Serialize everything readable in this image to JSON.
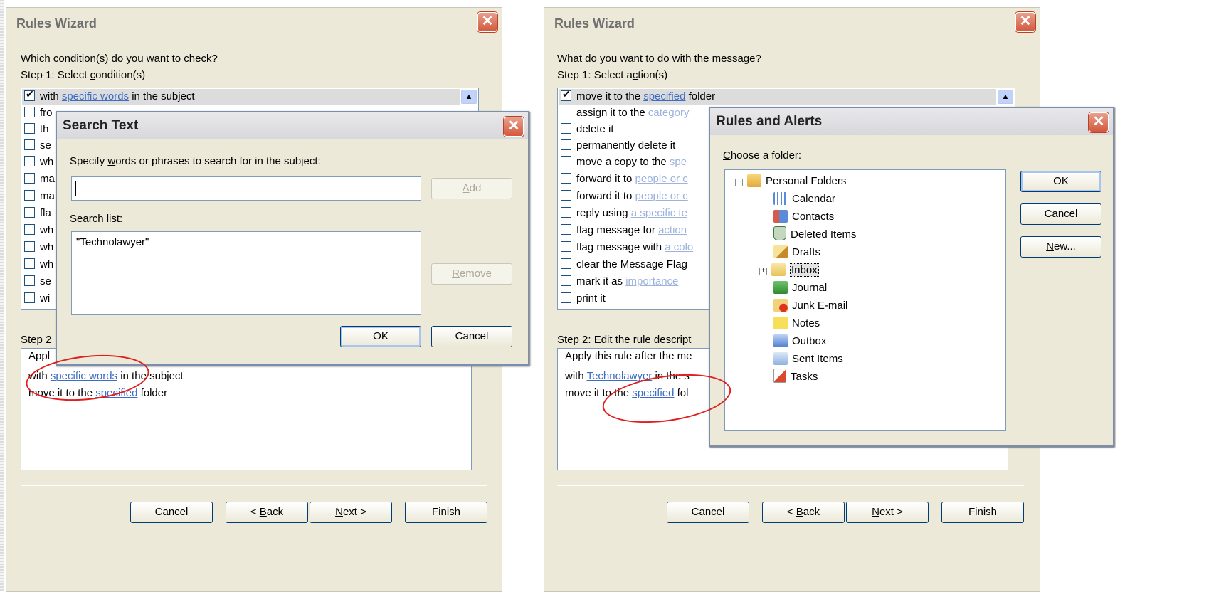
{
  "left_wizard": {
    "title": "Rules Wizard",
    "question": "Which condition(s) do you want to check?",
    "step1_pre": "Step 1: Select ",
    "step1_u": "c",
    "step1_post": "ondition(s)",
    "conditions": [
      {
        "label": "with ",
        "link": "specific words",
        "suffix": " in the subject",
        "checked": true
      },
      {
        "label": "fro"
      },
      {
        "label": "th"
      },
      {
        "label": "se"
      },
      {
        "label": "wh"
      },
      {
        "label": "ma"
      },
      {
        "label": "ma"
      },
      {
        "label": "fla"
      },
      {
        "label": "wh"
      },
      {
        "label": "wh"
      },
      {
        "label": "wh"
      },
      {
        "label": "se"
      },
      {
        "label": "wi"
      }
    ],
    "step2_label": "Step 2",
    "description": {
      "line1": "Appl",
      "line2_pre": "with ",
      "line2_link": "specific words",
      "line2_post": " in the subject",
      "line3_pre": "move it to the ",
      "line3_link": "specified",
      "line3_post": " folder"
    },
    "buttons": {
      "cancel": "Cancel",
      "back_pre": "< ",
      "back_u": "B",
      "back_post": "ack",
      "next_u": "N",
      "next_post": "ext >",
      "finish": "Finish"
    }
  },
  "search_text": {
    "title": "Search Text",
    "prompt_pre": "Specify ",
    "prompt_u": "w",
    "prompt_post": "ords or phrases to search for in the subject:",
    "input_value": "",
    "add_u": "A",
    "add_post": "dd",
    "list_u": "S",
    "list_post": "earch list:",
    "items": [
      "\"Technolawyer\""
    ],
    "remove_u": "R",
    "remove_post": "emove",
    "ok": "OK",
    "cancel": "Cancel"
  },
  "right_wizard": {
    "title": "Rules Wizard",
    "question": "What do you want to do with the message?",
    "step1_pre": "Step 1: Select a",
    "step1_u": "c",
    "step1_post": "tion(s)",
    "actions": [
      {
        "label": "move it to the ",
        "link": "specified",
        "suffix": " folder",
        "checked": true
      },
      {
        "label": "assign it to the ",
        "link": "category"
      },
      {
        "label": "delete it"
      },
      {
        "label": "permanently delete it"
      },
      {
        "label": "move a copy to the ",
        "link": "spe"
      },
      {
        "label": "forward it to ",
        "link": "people or c"
      },
      {
        "label": "forward it to ",
        "link": "people or c"
      },
      {
        "label": "reply using ",
        "link": "a specific te"
      },
      {
        "label": "flag message for ",
        "link": "action"
      },
      {
        "label": "flag message with ",
        "link": "a colo"
      },
      {
        "label": "clear the Message Flag"
      },
      {
        "label": "mark it as ",
        "link": "importance"
      },
      {
        "label": "print it"
      }
    ],
    "step2_pre": "Step 2: Edit the rule descript",
    "description": {
      "line1": "Apply this rule after the me",
      "line2_pre": "with ",
      "line2_link": "Technolawyer",
      "line2_post": " in the s",
      "line3_pre": "move it to the ",
      "line3_link": "specified",
      "line3_post": " fol"
    },
    "buttons": {
      "cancel": "Cancel",
      "back_pre": "< ",
      "back_u": "B",
      "back_post": "ack",
      "next_u": "N",
      "next_post": "ext >",
      "finish": "Finish"
    }
  },
  "rules_alerts": {
    "title": "Rules and Alerts",
    "prompt_u": "C",
    "prompt_post": "hoose a folder:",
    "root": "Personal Folders",
    "folders": [
      "Calendar",
      "Contacts",
      "Deleted Items",
      "Drafts",
      "Inbox",
      "Journal",
      "Junk E-mail",
      "Notes",
      "Outbox",
      "Sent Items",
      "Tasks"
    ],
    "selected_folder": "Inbox",
    "ok": "OK",
    "cancel": "Cancel",
    "new_u": "N",
    "new_post": "ew..."
  }
}
